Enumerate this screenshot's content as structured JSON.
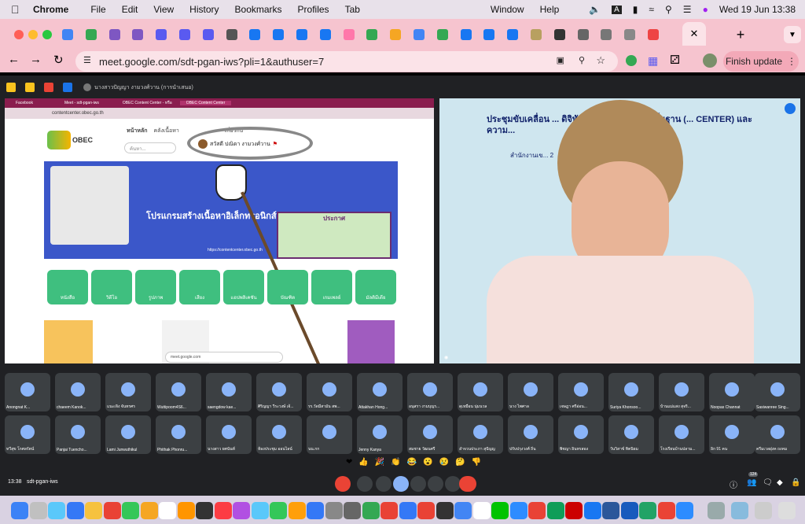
{
  "menubar": {
    "app": "Chrome",
    "items": [
      "File",
      "Edit",
      "View",
      "History",
      "Bookmarks",
      "Profiles",
      "Tab",
      "Window",
      "Help"
    ],
    "clock": "Wed 19 Jun  13:38"
  },
  "browser": {
    "url": "meet.google.com/sdt-pgan-iws?pli=1&authuser=7",
    "finish_update": "Finish update"
  },
  "meet": {
    "share_label": "นางสาวปัญญา งามวงศ์วาน (การนำเสนอ)",
    "shared_tabs": [
      "Facebook",
      "Meet - sdt-pgan-iws",
      "OBEC Content Center - หรือ",
      "OBEC Content Center"
    ],
    "shared_url": "contentcenter.obec.go.th",
    "shared_nav": [
      "หน้าหลัก",
      "คลังเนื้อหา",
      "เกี่ยวกับ"
    ],
    "shared_search": "ค้นหา...",
    "shared_user": "สวัสดี ปณิดา งามวงศ์วาน",
    "banner_title": "โปรแกรมสร้างเนื้อหาอิเล็กทรอนิกส์",
    "banner_url": "https://contentcenter.obec.go.th",
    "categories": [
      "หนังสือ",
      "วิดีโอ",
      "รูปภาพ",
      "เสียง",
      "แอปพลิเคชัน",
      "บัณฑิต",
      "เกมเพลย์",
      "มัลติมีเดีย"
    ],
    "notice_title": "ประกาศ",
    "speaker_banner": "ประชุมขับเคลื่อน ... ดิจิทัล ระดับการศึกษาขั้นพื้นฐาน (... CENTER) และความ...",
    "speaker_sub": "สำนักงานเข... 2",
    "time": "13:38",
    "meeting_code": "sdt-pgan-iws",
    "participant_count": "124"
  },
  "participants": [
    "Anongnat K...",
    "chaeem Kanok...",
    "แนะเจิง จันทรศร",
    "Wuttipoom4S6...",
    "saengdow kae...",
    "ศิริญญา วีระวงษ์ เจ้...",
    "รร.วัดมีสามัน สพ...",
    "Attakhan Hong...",
    "อนุสรา งามบุญร...",
    "ดุเหมือน นุ่มนวล",
    "นาง ไพศาล",
    "เจษฎา ศรีอ่อน...",
    "Suriya Khonsoo...",
    "บ้านแม่แสง สุจริ...",
    "Noopas Channat",
    "Sasiwanree Sing...",
    "ทวีสุข โกศลรัตน์",
    "Panjai Tuencho...",
    "Lami Junwuthikul",
    "Phithak Phonru...",
    "นางสาว ยศนันท์",
    "ห้องประชุม ออนไลน์",
    "นน.กก",
    "Jenny Kanya",
    "สมชาย วัฒนศรี",
    "ลำจวนประภา สุปัญญ",
    "ปรับปรุงวงศ์ ถิ่น",
    "พิชญา อินทรสอง",
    "วันวิสาข์ ทิตนิยม",
    "โรงเรียนบ้านปลาม...",
    "อิก 91 คน",
    "ครีมเวลฝุงค ถงคม"
  ]
}
